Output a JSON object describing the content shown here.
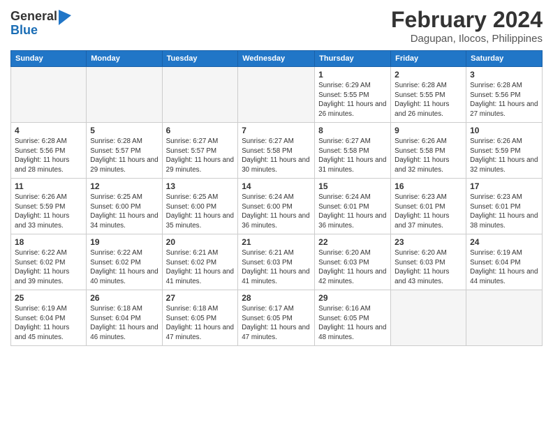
{
  "header": {
    "logo_general": "General",
    "logo_blue": "Blue",
    "month_year": "February 2024",
    "location": "Dagupan, Ilocos, Philippines"
  },
  "weekdays": [
    "Sunday",
    "Monday",
    "Tuesday",
    "Wednesday",
    "Thursday",
    "Friday",
    "Saturday"
  ],
  "weeks": [
    [
      {
        "day": "",
        "info": ""
      },
      {
        "day": "",
        "info": ""
      },
      {
        "day": "",
        "info": ""
      },
      {
        "day": "",
        "info": ""
      },
      {
        "day": "1",
        "info": "Sunrise: 6:29 AM\nSunset: 5:55 PM\nDaylight: 11 hours and 26 minutes."
      },
      {
        "day": "2",
        "info": "Sunrise: 6:28 AM\nSunset: 5:55 PM\nDaylight: 11 hours and 26 minutes."
      },
      {
        "day": "3",
        "info": "Sunrise: 6:28 AM\nSunset: 5:56 PM\nDaylight: 11 hours and 27 minutes."
      }
    ],
    [
      {
        "day": "4",
        "info": "Sunrise: 6:28 AM\nSunset: 5:56 PM\nDaylight: 11 hours and 28 minutes."
      },
      {
        "day": "5",
        "info": "Sunrise: 6:28 AM\nSunset: 5:57 PM\nDaylight: 11 hours and 29 minutes."
      },
      {
        "day": "6",
        "info": "Sunrise: 6:27 AM\nSunset: 5:57 PM\nDaylight: 11 hours and 29 minutes."
      },
      {
        "day": "7",
        "info": "Sunrise: 6:27 AM\nSunset: 5:58 PM\nDaylight: 11 hours and 30 minutes."
      },
      {
        "day": "8",
        "info": "Sunrise: 6:27 AM\nSunset: 5:58 PM\nDaylight: 11 hours and 31 minutes."
      },
      {
        "day": "9",
        "info": "Sunrise: 6:26 AM\nSunset: 5:58 PM\nDaylight: 11 hours and 32 minutes."
      },
      {
        "day": "10",
        "info": "Sunrise: 6:26 AM\nSunset: 5:59 PM\nDaylight: 11 hours and 32 minutes."
      }
    ],
    [
      {
        "day": "11",
        "info": "Sunrise: 6:26 AM\nSunset: 5:59 PM\nDaylight: 11 hours and 33 minutes."
      },
      {
        "day": "12",
        "info": "Sunrise: 6:25 AM\nSunset: 6:00 PM\nDaylight: 11 hours and 34 minutes."
      },
      {
        "day": "13",
        "info": "Sunrise: 6:25 AM\nSunset: 6:00 PM\nDaylight: 11 hours and 35 minutes."
      },
      {
        "day": "14",
        "info": "Sunrise: 6:24 AM\nSunset: 6:00 PM\nDaylight: 11 hours and 36 minutes."
      },
      {
        "day": "15",
        "info": "Sunrise: 6:24 AM\nSunset: 6:01 PM\nDaylight: 11 hours and 36 minutes."
      },
      {
        "day": "16",
        "info": "Sunrise: 6:23 AM\nSunset: 6:01 PM\nDaylight: 11 hours and 37 minutes."
      },
      {
        "day": "17",
        "info": "Sunrise: 6:23 AM\nSunset: 6:01 PM\nDaylight: 11 hours and 38 minutes."
      }
    ],
    [
      {
        "day": "18",
        "info": "Sunrise: 6:22 AM\nSunset: 6:02 PM\nDaylight: 11 hours and 39 minutes."
      },
      {
        "day": "19",
        "info": "Sunrise: 6:22 AM\nSunset: 6:02 PM\nDaylight: 11 hours and 40 minutes."
      },
      {
        "day": "20",
        "info": "Sunrise: 6:21 AM\nSunset: 6:02 PM\nDaylight: 11 hours and 41 minutes."
      },
      {
        "day": "21",
        "info": "Sunrise: 6:21 AM\nSunset: 6:03 PM\nDaylight: 11 hours and 41 minutes."
      },
      {
        "day": "22",
        "info": "Sunrise: 6:20 AM\nSunset: 6:03 PM\nDaylight: 11 hours and 42 minutes."
      },
      {
        "day": "23",
        "info": "Sunrise: 6:20 AM\nSunset: 6:03 PM\nDaylight: 11 hours and 43 minutes."
      },
      {
        "day": "24",
        "info": "Sunrise: 6:19 AM\nSunset: 6:04 PM\nDaylight: 11 hours and 44 minutes."
      }
    ],
    [
      {
        "day": "25",
        "info": "Sunrise: 6:19 AM\nSunset: 6:04 PM\nDaylight: 11 hours and 45 minutes."
      },
      {
        "day": "26",
        "info": "Sunrise: 6:18 AM\nSunset: 6:04 PM\nDaylight: 11 hours and 46 minutes."
      },
      {
        "day": "27",
        "info": "Sunrise: 6:18 AM\nSunset: 6:05 PM\nDaylight: 11 hours and 47 minutes."
      },
      {
        "day": "28",
        "info": "Sunrise: 6:17 AM\nSunset: 6:05 PM\nDaylight: 11 hours and 47 minutes."
      },
      {
        "day": "29",
        "info": "Sunrise: 6:16 AM\nSunset: 6:05 PM\nDaylight: 11 hours and 48 minutes."
      },
      {
        "day": "",
        "info": ""
      },
      {
        "day": "",
        "info": ""
      }
    ]
  ]
}
